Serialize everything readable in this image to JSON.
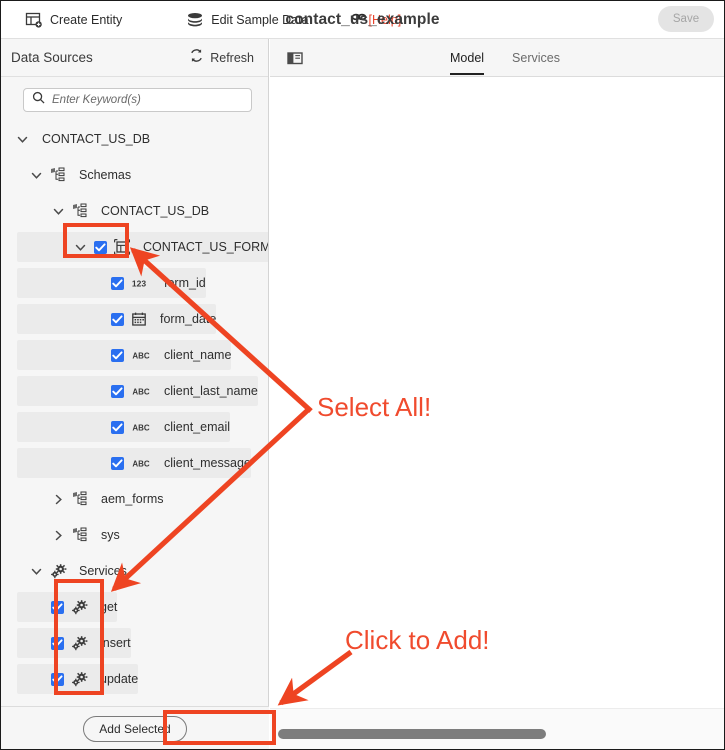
{
  "window": {
    "title": "contact_us_example"
  },
  "toolbar": {
    "create_entity_label": "Create Entity",
    "create_entity_icon": "table-add-icon",
    "edit_sample_data_label": "Edit Sample Data",
    "edit_sample_data_icon": "database-stack-icon",
    "help_label": "[Help]",
    "help_icon": "link-chain-icon",
    "save_label": "Save"
  },
  "sidebar": {
    "header_title": "Data Sources",
    "refresh_label": "Refresh",
    "refresh_icon": "refresh-icon",
    "search": {
      "placeholder": "Enter Keyword(s)",
      "value": "",
      "icon": "search-icon"
    },
    "tree": [
      {
        "label": "CONTACT_US_DB",
        "depth": 0,
        "expanded": true,
        "chevron": "chevron-down-icon",
        "icon": null,
        "checkbox": null,
        "shaded": false
      },
      {
        "label": "Schemas",
        "depth": 1,
        "expanded": true,
        "chevron": "chevron-down-icon",
        "icon": "schema-icon",
        "checkbox": null,
        "shaded": false
      },
      {
        "label": "CONTACT_US_DB",
        "depth": 2,
        "expanded": true,
        "chevron": "chevron-down-icon",
        "icon": "schema-icon",
        "checkbox": null,
        "shaded": false
      },
      {
        "label": "CONTACT_US_FORMS",
        "depth": 3,
        "expanded": true,
        "chevron": "chevron-down-icon",
        "icon": "table-icon",
        "checkbox": "checked",
        "shaded": true
      },
      {
        "label": "form_id",
        "depth": 4,
        "expanded": null,
        "chevron": null,
        "icon": "number-123-icon",
        "checkbox": "checked",
        "shaded": true
      },
      {
        "label": "form_date",
        "depth": 4,
        "expanded": null,
        "chevron": null,
        "icon": "calendar-icon",
        "checkbox": "checked",
        "shaded": true
      },
      {
        "label": "client_name",
        "depth": 4,
        "expanded": null,
        "chevron": null,
        "icon": "text-abc-icon",
        "checkbox": "checked",
        "shaded": true
      },
      {
        "label": "client_last_name",
        "depth": 4,
        "expanded": null,
        "chevron": null,
        "icon": "text-abc-icon",
        "checkbox": "checked",
        "shaded": true
      },
      {
        "label": "client_email",
        "depth": 4,
        "expanded": null,
        "chevron": null,
        "icon": "text-abc-icon",
        "checkbox": "checked",
        "shaded": true
      },
      {
        "label": "client_message",
        "depth": 4,
        "expanded": null,
        "chevron": null,
        "icon": "text-abc-icon",
        "checkbox": "checked",
        "shaded": true
      },
      {
        "label": "aem_forms",
        "depth": 2,
        "expanded": false,
        "chevron": "chevron-right-icon",
        "icon": "schema-icon",
        "checkbox": null,
        "shaded": false
      },
      {
        "label": "sys",
        "depth": 2,
        "expanded": false,
        "chevron": "chevron-right-icon",
        "icon": "schema-icon",
        "checkbox": null,
        "shaded": false
      },
      {
        "label": "Services",
        "depth": 1,
        "expanded": true,
        "chevron": "chevron-down-icon",
        "icon": "gears-icon",
        "checkbox": null,
        "shaded": false
      },
      {
        "label": "get",
        "depth": 2,
        "expanded": null,
        "chevron": null,
        "icon": "gears-icon",
        "checkbox": "checked",
        "shaded": true
      },
      {
        "label": "insert",
        "depth": 2,
        "expanded": null,
        "chevron": null,
        "icon": "gears-icon",
        "checkbox": "checked",
        "shaded": true
      },
      {
        "label": "update",
        "depth": 2,
        "expanded": null,
        "chevron": null,
        "icon": "gears-icon",
        "checkbox": "checked",
        "shaded": true
      }
    ],
    "add_selected_label": "Add Selected"
  },
  "right_panel": {
    "panel_toggle_icon": "panel-layout-icon",
    "tabs": [
      {
        "label": "Model",
        "active": true
      },
      {
        "label": "Services",
        "active": false
      }
    ]
  },
  "annotations": {
    "select_all_text": "Select All!",
    "click_to_add_text": "Click to Add!",
    "color": "#f04b2e"
  }
}
